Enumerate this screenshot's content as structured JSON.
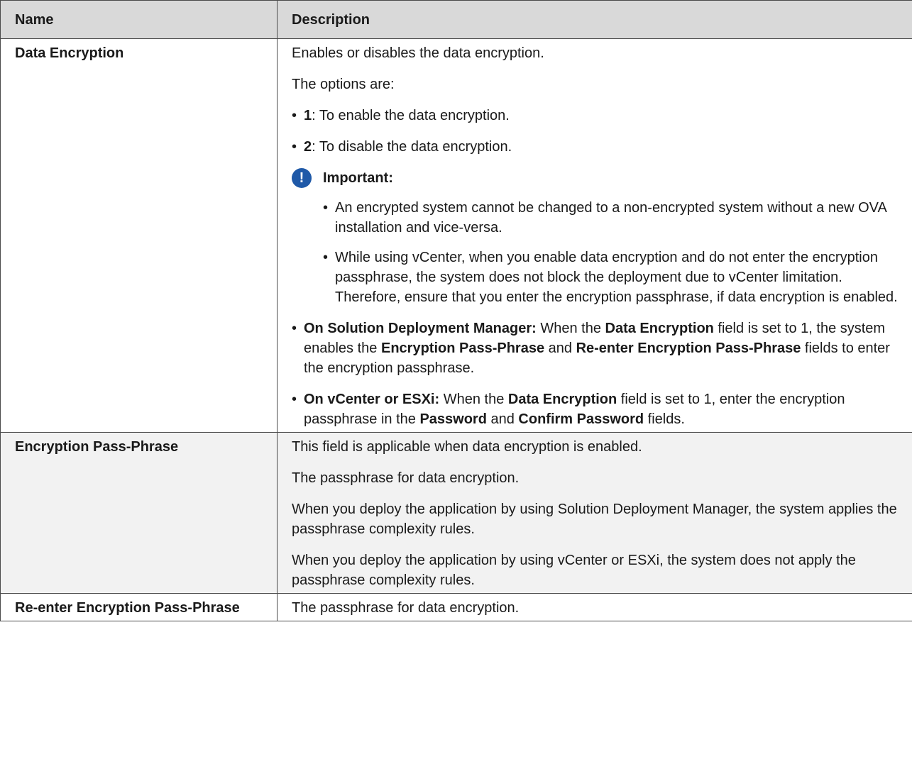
{
  "table": {
    "headers": [
      "Name",
      "Description"
    ],
    "rows": [
      {
        "name": "Data Encryption",
        "desc1": "Enables or disables the data encryption.",
        "desc2": "The options are:",
        "opt1_key": "1",
        "opt1_text": ": To enable the data encryption.",
        "opt2_key": "2",
        "opt2_text": ": To disable the data encryption.",
        "important_label": "Important:",
        "imp1": "An encrypted system cannot be changed to a non-encrypted system without a new OVA installation and vice-versa.",
        "imp2": "While using vCenter, when you enable data encryption and do not enter the encryption passphrase, the system does not block the deployment due to vCenter limitation. Therefore, ensure that you enter the encryption passphrase, if data encryption is enabled.",
        "sdm": {
          "lead": "On Solution Deployment Manager:",
          "t1": " When the ",
          "b1": "Data Encryption",
          "t2": " field is set to 1, the system enables the ",
          "b2": "Encryption Pass-Phrase",
          "t3": " and ",
          "b3": "Re-enter Encryption Pass-Phrase",
          "t4": " fields to enter the encryption passphrase."
        },
        "esx": {
          "lead": "On vCenter or ESXi:",
          "t1": " When the ",
          "b1": "Data Encryption",
          "t2": " field is set to 1, enter the encryption passphrase in the ",
          "b2": "Password",
          "t3": " and ",
          "b3": "Confirm Password",
          "t4": " fields."
        }
      },
      {
        "name": "Encryption Pass-Phrase",
        "p1": "This field is applicable when data encryption is enabled.",
        "p2": "The passphrase for data encryption.",
        "p3": "When you deploy the application by using Solution Deployment Manager, the system applies the passphrase complexity rules.",
        "p4": "When you deploy the application by using vCenter or ESXi, the system does not apply the passphrase complexity rules."
      },
      {
        "name": "Re-enter Encryption Pass-Phrase",
        "p1": "The passphrase for data encryption."
      }
    ]
  },
  "icons": {
    "important": "exclamation-circle-icon",
    "important_glyph": "!",
    "bullet_glyph": "•"
  },
  "colors": {
    "header_bg": "#d9d9d9",
    "shaded_row_bg": "#f2f2f2",
    "important_icon": "#1f59a8"
  }
}
